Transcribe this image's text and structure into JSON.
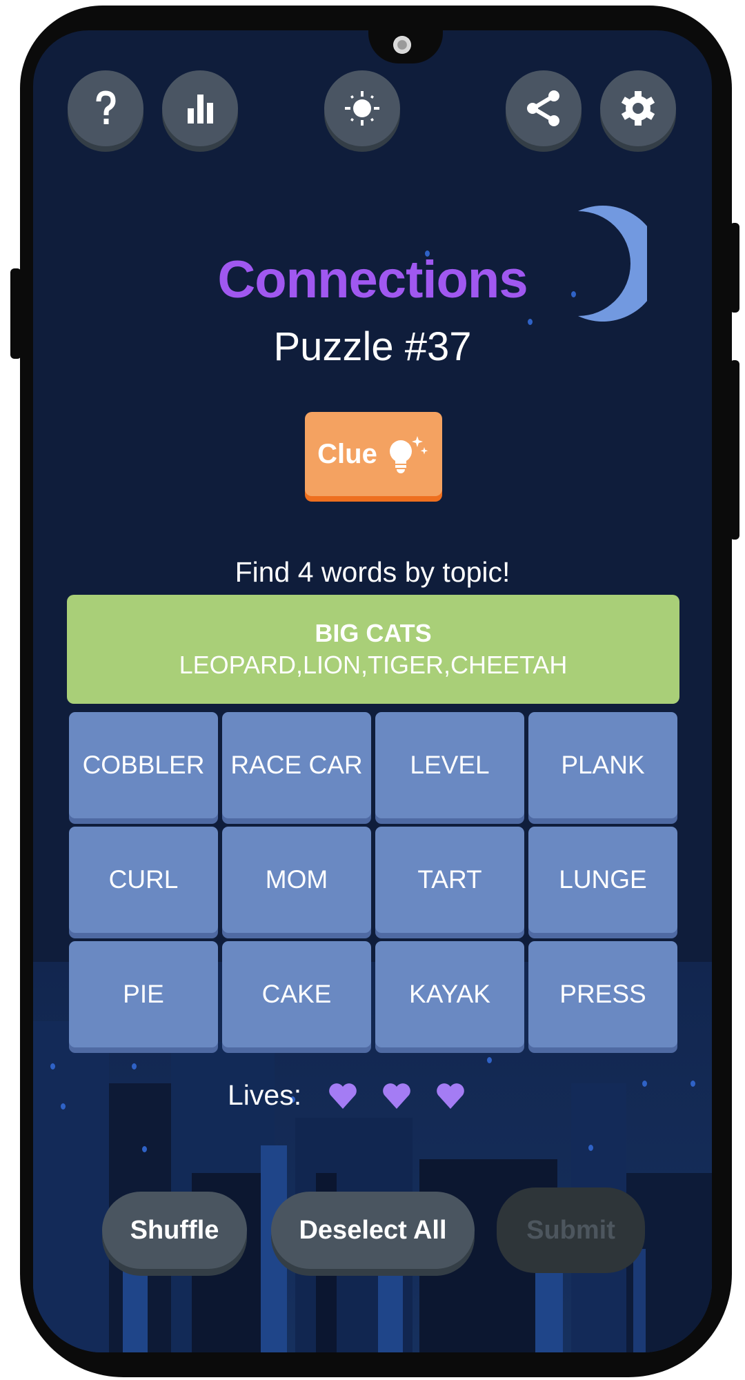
{
  "header": {
    "help_icon": "help-icon",
    "stats_icon": "bar-chart-icon",
    "theme_icon": "sun-icon",
    "share_icon": "share-icon",
    "settings_icon": "gear-icon"
  },
  "title": "Connections",
  "subtitle": "Puzzle #37",
  "clue_button": {
    "label": "Clue",
    "icon": "lightbulb-sparkle-icon"
  },
  "instruction": "Find 4 words by topic!",
  "solved_groups": [
    {
      "category": "BIG CATS",
      "words": "LEOPARD,LION,TIGER,CHEETAH",
      "color": "#a9cf78"
    }
  ],
  "tiles": [
    "COBBLER",
    "RACE CAR",
    "LEVEL",
    "PLANK",
    "CURL",
    "MOM",
    "TART",
    "LUNGE",
    "PIE",
    "CAKE",
    "KAYAK",
    "PRESS"
  ],
  "lives": {
    "label": "Lives:",
    "remaining": 3,
    "total": 3,
    "heart_color": "#a47cf4"
  },
  "actions": {
    "shuffle": "Shuffle",
    "deselect_all": "Deselect All",
    "submit": "Submit",
    "submit_enabled": false
  },
  "colors": {
    "background": "#0f1d3b",
    "title": "#a058f0",
    "tile": "#6a89c2",
    "clue": "#f4a261",
    "button": "#4a5560"
  }
}
